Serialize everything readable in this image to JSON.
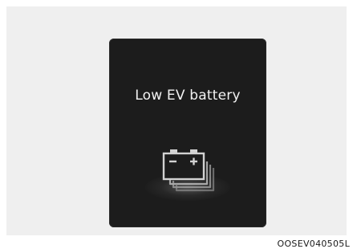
{
  "display": {
    "message": "Low EV battery",
    "icon": "ev-battery-warning-icon"
  },
  "figure": {
    "code": "OOSEV040505L"
  },
  "colors": {
    "screen_background": "#1c1c1c",
    "message_text": "#f2f2f2",
    "icon_stroke": "#cfcfcf",
    "page_background": "#efefef"
  }
}
